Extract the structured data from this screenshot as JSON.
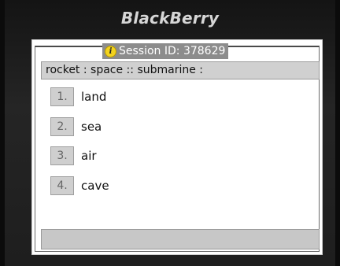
{
  "device": {
    "brand": "BlackBerry"
  },
  "session": {
    "label": "Session ID: 378629",
    "icon": "info-icon"
  },
  "question": {
    "text": "rocket : space :: submarine :"
  },
  "answers": [
    {
      "number": "1.",
      "label": "land"
    },
    {
      "number": "2.",
      "label": "sea"
    },
    {
      "number": "3.",
      "label": "air"
    },
    {
      "number": "4.",
      "label": "cave"
    }
  ],
  "colors": {
    "badge_background": "#8c8c8c",
    "info_icon": "#f3d31e",
    "question_bar": "#d0d0d0"
  }
}
